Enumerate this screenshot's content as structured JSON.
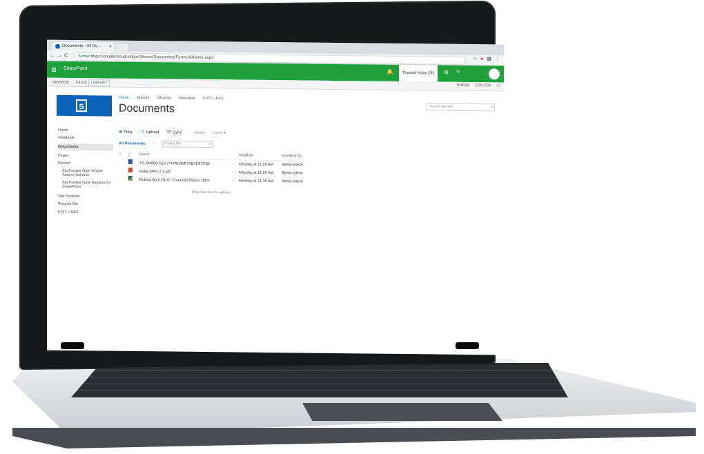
{
  "browser": {
    "tab_title": "Documents - All Do...",
    "tab_close": "×",
    "secure_label": "Sicher",
    "url": "https://onisdemouat.office/Shared Documents/Forms/AllItems.aspx",
    "back": "←",
    "forward": "→",
    "reload": "C"
  },
  "suite": {
    "waffle": "⊞",
    "brand": "SharePoint",
    "trusted_label": "Trusted Hubs ON",
    "gear": "⚙",
    "help": "?"
  },
  "ribbon": {
    "tabs": [
      "BROWSE",
      "FILES",
      "LIBRARY"
    ],
    "share": "SHARE",
    "follow": "FOLLOW",
    "more": "⬜"
  },
  "site": {
    "toplinks": [
      "Home",
      "Subsite",
      "Shadow",
      "Metadata",
      "EDIT LINKS"
    ],
    "title": "Documents",
    "search_placeholder": "Search this site"
  },
  "leftnav": {
    "items": [
      "Home",
      "Notebook",
      "Documents",
      "Pages",
      "Recent",
      "SkyTrusted Gate Mobile Access Solution",
      "SkyTrusted Gate Solution for SharePoint",
      "Site contents",
      "Recycle Bin",
      "EDIT LINKS"
    ]
  },
  "commands": {
    "new": "New",
    "upload": "Upload",
    "sync": "Sync",
    "share": "Share",
    "more": "more ▾",
    "view": "All Documents",
    "view_more": "···",
    "find": "Find a file"
  },
  "documents": {
    "headers": {
      "name": "Name",
      "modified": "Modified",
      "modified_by": "Modified By"
    },
    "rows": [
      {
        "name": "TG-SH000-GLA7YH4KJWP7AB4E97P3B-",
        "modified": "Monday at 11:29 AM",
        "by": "Stefan Alexe"
      },
      {
        "name": "BalanZiffer-2.3.pdf",
        "modified": "Monday at 11:29 AM",
        "by": "Stefan Alexe"
      },
      {
        "name": "Rollout April 2016 - Financial Status .docx",
        "modified": "Monday at 11:35 AM",
        "by": "Stefan Alexe"
      }
    ],
    "drop_hint": "Drag files here to upload"
  },
  "colors": {
    "suite_green": "#1ea13a",
    "brand_blue": "#0a63b8"
  }
}
